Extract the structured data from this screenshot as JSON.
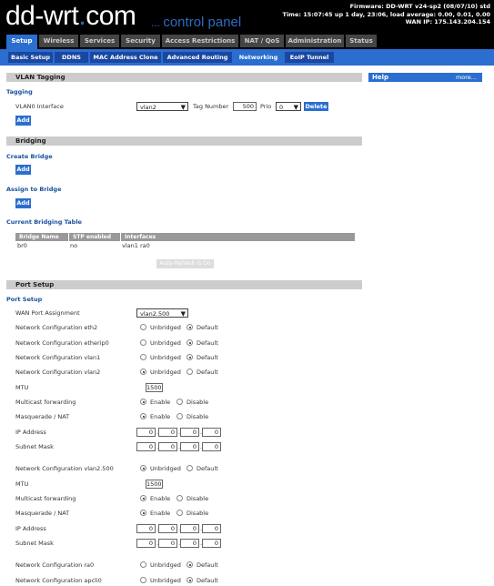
{
  "header": {
    "logo_text": "dd-wrt",
    "logo_dot": ".",
    "logo_com": "com",
    "control_panel": "control panel",
    "firmware": "Firmware: DD-WRT v24-sp2 (08/07/10) std",
    "time": "Time: 15:07:45 up 1 day, 23:06, load average: 0.00, 0.01, 0.00",
    "wan_ip": "WAN IP: 175.143.204.154"
  },
  "main_tabs": [
    "Setup",
    "Wireless",
    "Services",
    "Security",
    "Access Restrictions",
    "NAT / QoS",
    "Administration",
    "Status"
  ],
  "sub_tabs": [
    "Basic Setup",
    "DDNS",
    "MAC Address Clone",
    "Advanced Routing",
    "Networking",
    "EoIP Tunnel"
  ],
  "help": {
    "title": "Help",
    "more": "more..."
  },
  "vlan": {
    "section_title": "VLAN Tagging",
    "subtitle": "Tagging",
    "interface_label": "VLAN0 Interface",
    "interface_value": "vlan2",
    "tag_number_label": "Tag Number",
    "tag_number_value": "500",
    "prio_label": "Prio",
    "prio_value": "0",
    "delete_label": "Delete",
    "add_label": "Add"
  },
  "bridging": {
    "section_title": "Bridging",
    "create_title": "Create Bridge",
    "assign_title": "Assign to Bridge",
    "current_title": "Current Bridging Table",
    "add_label": "Add",
    "table_headers": [
      "Bridge Name",
      "STP enabled",
      "Interfaces"
    ],
    "table_rows": [
      [
        "br0",
        "no",
        "vlan1 ra0"
      ]
    ],
    "autorefresh_label": "Auto-Refresh is On"
  },
  "port": {
    "section_title": "Port Setup",
    "subtitle": "Port Setup",
    "wan_label": "WAN Port Assignment",
    "wan_value": "vlan2.500",
    "unbridged": "Unbridged",
    "default": "Default",
    "enable": "Enable",
    "disable": "Disable",
    "net_eth2": "Network Configuration eth2",
    "net_etherip0": "Network Configuration etherip0",
    "net_vlan1": "Network Configuration vlan1",
    "net_vlan2": "Network Configuration vlan2",
    "mtu_label": "MTU",
    "mtu_value": "1500",
    "multicast_label": "Multicast forwarding",
    "masq_label": "Masquerade / NAT",
    "ip_label": "IP Address",
    "subnet_label": "Subnet Mask",
    "ip_octet": "0",
    "net_vlan2_500": "Network Configuration vlan2.500",
    "mtu2_value": "1500",
    "net_ra0": "Network Configuration ra0",
    "net_apcli0": "Network Configuration apcli0"
  }
}
